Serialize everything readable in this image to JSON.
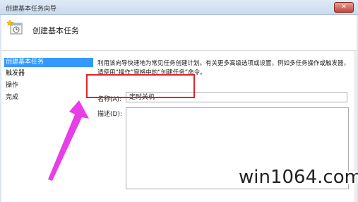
{
  "window": {
    "title": "创建基本任务向导",
    "close_label": "✕"
  },
  "header": {
    "title": "创建基本任务"
  },
  "sidebar": {
    "items": [
      {
        "label": "创建基本任务",
        "active": true
      },
      {
        "label": "触发器",
        "active": false
      },
      {
        "label": "操作",
        "active": false
      },
      {
        "label": "完成",
        "active": false
      }
    ]
  },
  "main": {
    "intro_text": "利用该向导快速地为常见任务创建计划。有关更多高级选项或设置，例如多任务操作或触发器，请使用“操作”窗格中的“创建任务”命令。",
    "name_label": "名称(A):",
    "name_value": "定时关机",
    "description_label": "描述(D):",
    "description_value": ""
  },
  "annotation": {
    "highlight_color": "#e0242a",
    "arrow_color": "#e83ee8"
  },
  "watermark": "win1064.com"
}
